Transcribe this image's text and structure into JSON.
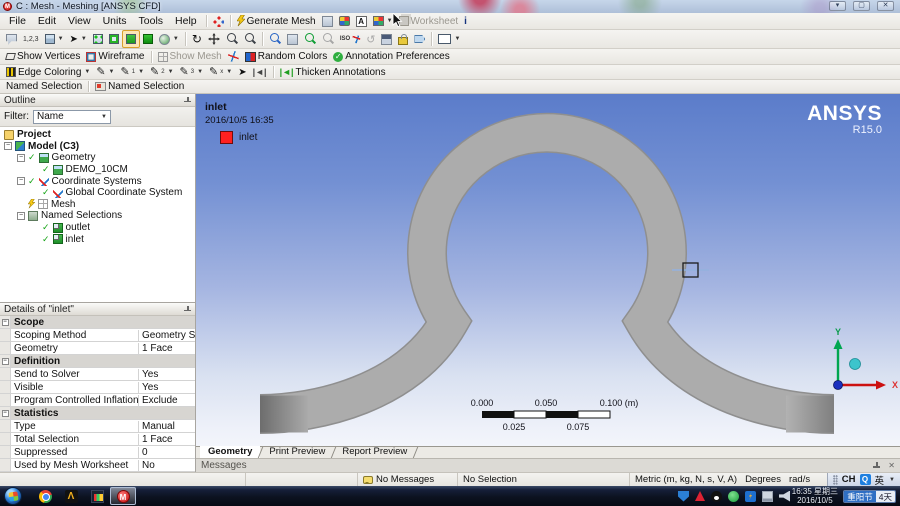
{
  "window": {
    "title": "C : Mesh - Meshing [ANSYS CFD]",
    "icon_letter": "M"
  },
  "menus": [
    "File",
    "Edit",
    "View",
    "Units",
    "Tools",
    "Help"
  ],
  "tb1": {
    "generate_mesh": "Generate Mesh",
    "worksheet": "Worksheet",
    "info_glyph": "i"
  },
  "tb2": {
    "iso": "ISO"
  },
  "tb3": {
    "show_vertices": "Show Vertices",
    "wireframe": "Wireframe",
    "show_mesh": "Show Mesh",
    "random_colors": "Random Colors",
    "annotation_preferences": "Annotation Preferences"
  },
  "tb4": {
    "edge_coloring": "Edge Coloring",
    "thicken_annotations": "Thicken Annotations"
  },
  "ns_toolbar": {
    "label": "Named Selection",
    "button": "Named Selection"
  },
  "outline": {
    "title": "Outline",
    "filter_label": "Filter:",
    "filter_value": "Name",
    "tree": [
      {
        "label": "Project"
      },
      {
        "label": "Model (C3)"
      },
      {
        "label": "Geometry"
      },
      {
        "label": "DEMO_10CM"
      },
      {
        "label": "Coordinate Systems"
      },
      {
        "label": "Global Coordinate System"
      },
      {
        "label": "Mesh"
      },
      {
        "label": "Named Selections"
      },
      {
        "label": "outlet"
      },
      {
        "label": "inlet"
      }
    ]
  },
  "details": {
    "title": "Details of \"inlet\"",
    "rows": [
      {
        "t": "h",
        "label": "Scope"
      },
      {
        "t": "r",
        "label": "Scoping Method",
        "value": "Geometry Selection"
      },
      {
        "t": "r",
        "label": "Geometry",
        "value": "1 Face"
      },
      {
        "t": "h",
        "label": "Definition"
      },
      {
        "t": "r",
        "label": "Send to Solver",
        "value": "Yes"
      },
      {
        "t": "r",
        "label": "Visible",
        "value": "Yes"
      },
      {
        "t": "r",
        "label": "Program Controlled Inflation",
        "value": "Exclude"
      },
      {
        "t": "h",
        "label": "Statistics"
      },
      {
        "t": "r",
        "label": "Type",
        "value": "Manual"
      },
      {
        "t": "r",
        "label": "Total Selection",
        "value": "1 Face"
      },
      {
        "t": "r",
        "label": "Suppressed",
        "value": "0"
      },
      {
        "t": "r",
        "label": "Used by Mesh Worksheet",
        "value": "No"
      }
    ]
  },
  "viewport": {
    "annotation_title": "inlet",
    "timestamp": "2016/10/5 16:35",
    "legend_label": "inlet",
    "logo_line1": "ANSYS",
    "logo_line2": "R15.0",
    "ruler": {
      "top_labels": [
        "0.000",
        "0.050",
        "0.100 (m)"
      ],
      "bottom_labels": [
        "0.025",
        "0.075"
      ]
    },
    "triad": {
      "x_label": "X",
      "y_label": "Y"
    }
  },
  "tabs": [
    "Geometry",
    "Print Preview",
    "Report Preview"
  ],
  "messages_bar": {
    "title": "Messages"
  },
  "status_bar": {
    "no_messages": "No Messages",
    "no_selection": "No Selection",
    "units": "Metric (m, kg, N, s, V, A)",
    "angle": "Degrees",
    "angular_velocity": "rad/s",
    "lang_ch": "CH",
    "lang_q": "Q",
    "lang_en": "英"
  },
  "taskbar": {
    "clock_time": "16:35 星期三",
    "clock_date": "2016/10/5",
    "badge_left": "重阳节",
    "badge_right": "4天"
  },
  "icons": {
    "generate-mesh-icon": "yellow lightning bolt",
    "meshing-app-icon": "red circle with white M",
    "legend-swatch": "red square",
    "triad": "green Y up, red X right, cyan Z sphere"
  },
  "colors": {
    "viewport_top": "#5b7cca",
    "viewport_bottom": "#f3f5fb",
    "pipe_gray": "#ababab",
    "legend_red": "#ff2020",
    "axis_x_red": "#cc1111",
    "axis_y_green": "#00a650"
  }
}
